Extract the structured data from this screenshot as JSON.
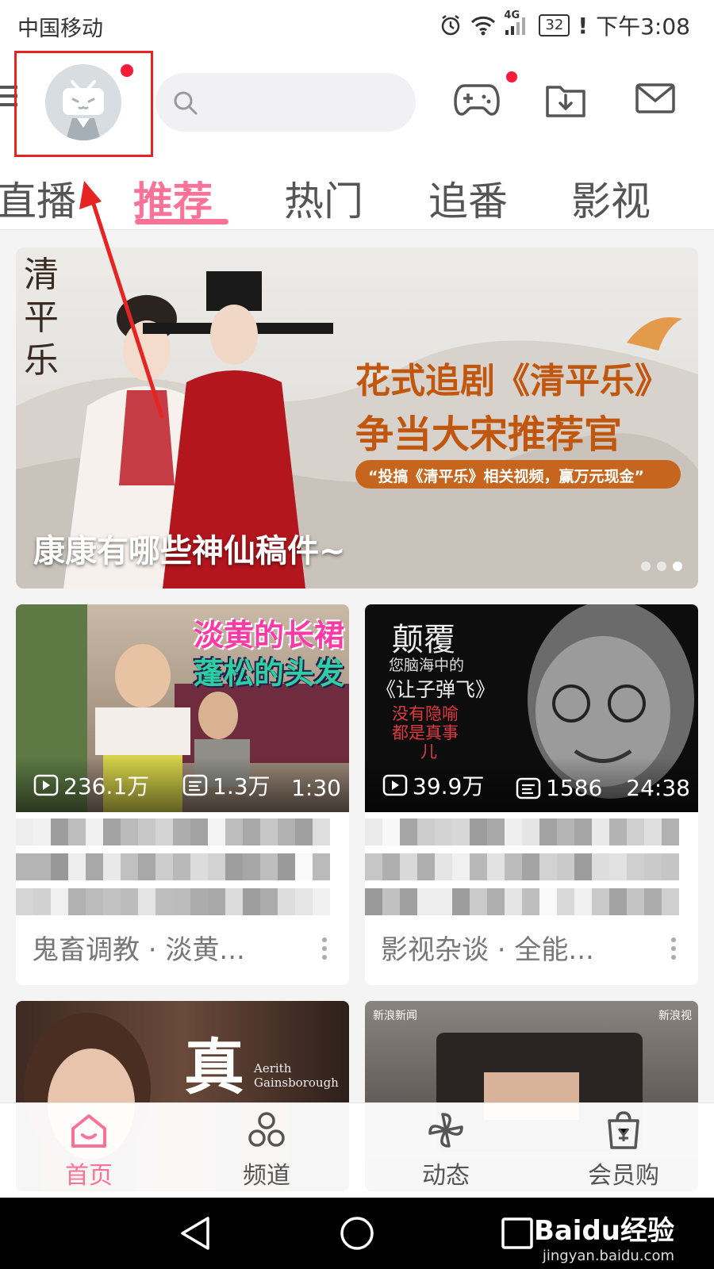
{
  "status_bar": {
    "carrier": "中国移动",
    "network": "4G",
    "battery": "32",
    "time": "下午3:08"
  },
  "header": {
    "search_placeholder": "",
    "icons": [
      "menu-icon",
      "avatar",
      "search-icon",
      "game-controller-icon",
      "download-icon",
      "mail-icon"
    ]
  },
  "tabs": [
    {
      "label": "直播",
      "active": false
    },
    {
      "label": "推荐",
      "active": true
    },
    {
      "label": "热门",
      "active": false
    },
    {
      "label": "追番",
      "active": false
    },
    {
      "label": "影视",
      "active": false
    }
  ],
  "banner": {
    "vertical_title": "清平乐",
    "promo_line1": "花式追剧《清平乐》",
    "promo_line2": "争当大宋推荐官",
    "promo_line3": "“投搞《清平乐》相关视频，赢万元现金”",
    "caption": "康康有哪些神仙稿件~",
    "slide_count": 3,
    "active_slide": 3
  },
  "cards": [
    {
      "thumb_text1": "淡黄的长裙",
      "thumb_text2": "蓬松的头发",
      "views": "236.1万",
      "danmaku": "1.3万",
      "duration": "1:30",
      "meta": "鬼畜调教 · 淡黄..."
    },
    {
      "thumb_text1": "颠覆",
      "thumb_text2": "您脑海中的",
      "thumb_text3": "《让子弹飞》",
      "thumb_text4": "没有隐喻",
      "thumb_text5": "都是真事",
      "thumb_text6": "儿",
      "views": "39.9万",
      "danmaku": "1586",
      "duration": "24:38",
      "meta": "影视杂谈 · 全能..."
    },
    {
      "thumb_text1": "真",
      "thumb_text2": "Aerith",
      "thumb_text3": "Gainsborough"
    },
    {
      "thumb_text1": "新浪新闻",
      "thumb_text2": "新浪视"
    }
  ],
  "bottom_nav": [
    {
      "label": "首页",
      "icon": "home-icon",
      "active": true
    },
    {
      "label": "频道",
      "icon": "channel-icon",
      "active": false
    },
    {
      "label": "动态",
      "icon": "pinwheel-icon",
      "active": false
    },
    {
      "label": "会员购",
      "icon": "shopping-bag-icon",
      "active": false
    }
  ],
  "watermark": {
    "main": "Baidu经验",
    "sub": "jingyan.baidu.com"
  },
  "colors": {
    "accent": "#fb7299",
    "badge": "#fb1a3a",
    "annotation": "#e52424"
  }
}
